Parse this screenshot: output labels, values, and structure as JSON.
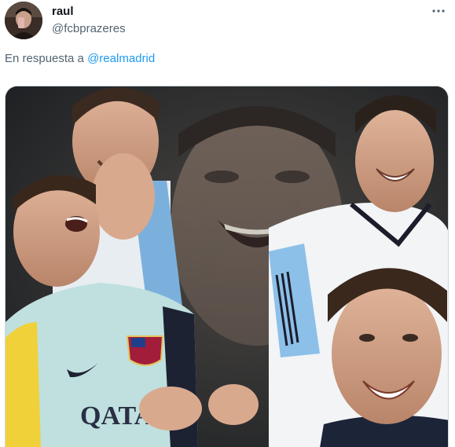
{
  "tweet": {
    "author": {
      "display_name": "raul",
      "handle": "@fcbprazeres"
    },
    "more_icon": "more-dots-icon",
    "reply_prefix": "En respuesta a",
    "reply_mention": "@realmadrid",
    "media": {
      "jersey_text": "QATA"
    }
  },
  "colors": {
    "text_primary": "#0f1419",
    "text_secondary": "#536471",
    "link": "#1d9bf0",
    "border": "#cfd9de"
  }
}
